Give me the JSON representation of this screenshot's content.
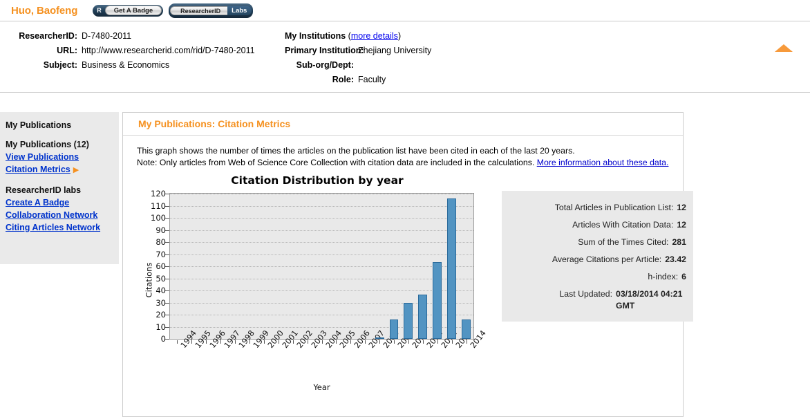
{
  "header": {
    "person_name": "Huo, Baofeng",
    "badge_pill": {
      "chip": "R",
      "label": "Get A Badge"
    },
    "rid_pill": {
      "label": "ResearcherID",
      "labs": "Labs"
    },
    "collapse_icon": "triangle-up-icon"
  },
  "profile": {
    "left": [
      {
        "key": "ResearcherID:",
        "value": "D-7480-2011"
      },
      {
        "key": "URL:",
        "value": "http://www.researcherid.com/rid/D-7480-2011"
      },
      {
        "key": "Subject:",
        "value": "Business & Economics"
      }
    ],
    "institutions_heading": "My Institutions",
    "more_details_link": "more details",
    "right": [
      {
        "key": "Primary Institution:",
        "value": "Zhejiang University"
      },
      {
        "key": "Sub-org/Dept:",
        "value": ""
      },
      {
        "key": "Role:",
        "value": "Faculty"
      }
    ]
  },
  "sidebar": {
    "heading": "My Publications",
    "publications_label": "My Publications (12)",
    "links": [
      {
        "label": "View Publications",
        "arrow": ""
      },
      {
        "label": "Citation Metrics",
        "arrow": "▶"
      }
    ],
    "labs_heading": "ResearcherID labs",
    "labs_links": [
      {
        "label": "Create A Badge"
      },
      {
        "label": "Collaboration Network"
      },
      {
        "label": "Citing Articles Network"
      }
    ]
  },
  "main": {
    "panel_title": "My Publications: Citation Metrics",
    "description_line1": "This graph shows the number of times the articles on the publication list have been cited in each of the last 20 years.",
    "description_line2_prefix": "Note: Only articles from Web of Science Core Collection with citation data are included in the calculations.",
    "description_link": "More information about these data.",
    "metrics": [
      {
        "label": "Total Articles in Publication List:",
        "value": "12"
      },
      {
        "label": "Articles With Citation Data:",
        "value": "12"
      },
      {
        "label": "Sum of the Times Cited:",
        "value": "281"
      },
      {
        "label": "Average Citations per Article:",
        "value": "23.42"
      },
      {
        "label": "h-index:",
        "value": "6"
      },
      {
        "label": "Last Updated:",
        "value": "03/18/2014 04:21 GMT"
      }
    ]
  },
  "chart_data": {
    "type": "bar",
    "title": "Citation Distribution by year",
    "xlabel": "Year",
    "ylabel": "Citations",
    "categories": [
      "1994",
      "1995",
      "1996",
      "1997",
      "1998",
      "1999",
      "2000",
      "2001",
      "2002",
      "2003",
      "2004",
      "2005",
      "2006",
      "2007",
      "2008",
      "2009",
      "2010",
      "2011",
      "2012",
      "2013",
      "2014"
    ],
    "values": [
      0,
      0,
      0,
      0,
      0,
      0,
      0,
      0,
      0,
      0,
      0,
      0,
      0,
      0,
      1,
      16,
      30,
      37,
      64,
      117,
      16
    ],
    "ylim": [
      0,
      120
    ],
    "yticks": [
      0,
      10,
      20,
      30,
      40,
      50,
      60,
      70,
      80,
      90,
      100,
      110,
      120
    ],
    "grid": true,
    "legend": "none",
    "bar_color": "#5294c2",
    "bar_border_color": "#2a6a9b",
    "plot_background": "#e9e9e9"
  },
  "colors": {
    "accent_orange": "#f59120",
    "link_blue": "#0033cc",
    "panel_border": "#cccccc",
    "sidebar_bg": "#eaeaea"
  }
}
